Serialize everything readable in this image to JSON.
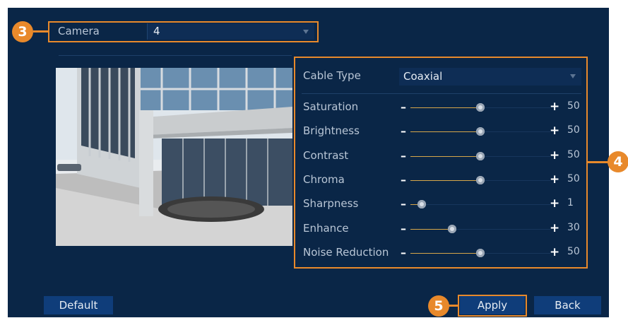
{
  "badges": {
    "camera": "3",
    "settings": "4",
    "apply": "5"
  },
  "camera": {
    "label": "Camera",
    "value": "4"
  },
  "cable_type": {
    "label": "Cable Type",
    "value": "Coaxial"
  },
  "sliders": [
    {
      "name": "Saturation",
      "value": "50",
      "level": 0.5
    },
    {
      "name": "Brightness",
      "value": "50",
      "level": 0.5
    },
    {
      "name": "Contrast",
      "value": "50",
      "level": 0.5
    },
    {
      "name": "Chroma",
      "value": "50",
      "level": 0.5
    },
    {
      "name": "Sharpness",
      "value": "1",
      "level": 0.08
    },
    {
      "name": "Enhance",
      "value": "30",
      "level": 0.3
    },
    {
      "name": "Noise Reduction",
      "value": "50",
      "level": 0.5
    }
  ],
  "buttons": {
    "default": "Default",
    "apply": "Apply",
    "back": "Back"
  },
  "colors": {
    "accent": "#e8892b",
    "panel": "#0a2647",
    "button": "#0f3d7a",
    "slider_fill": "#d6a64a"
  }
}
